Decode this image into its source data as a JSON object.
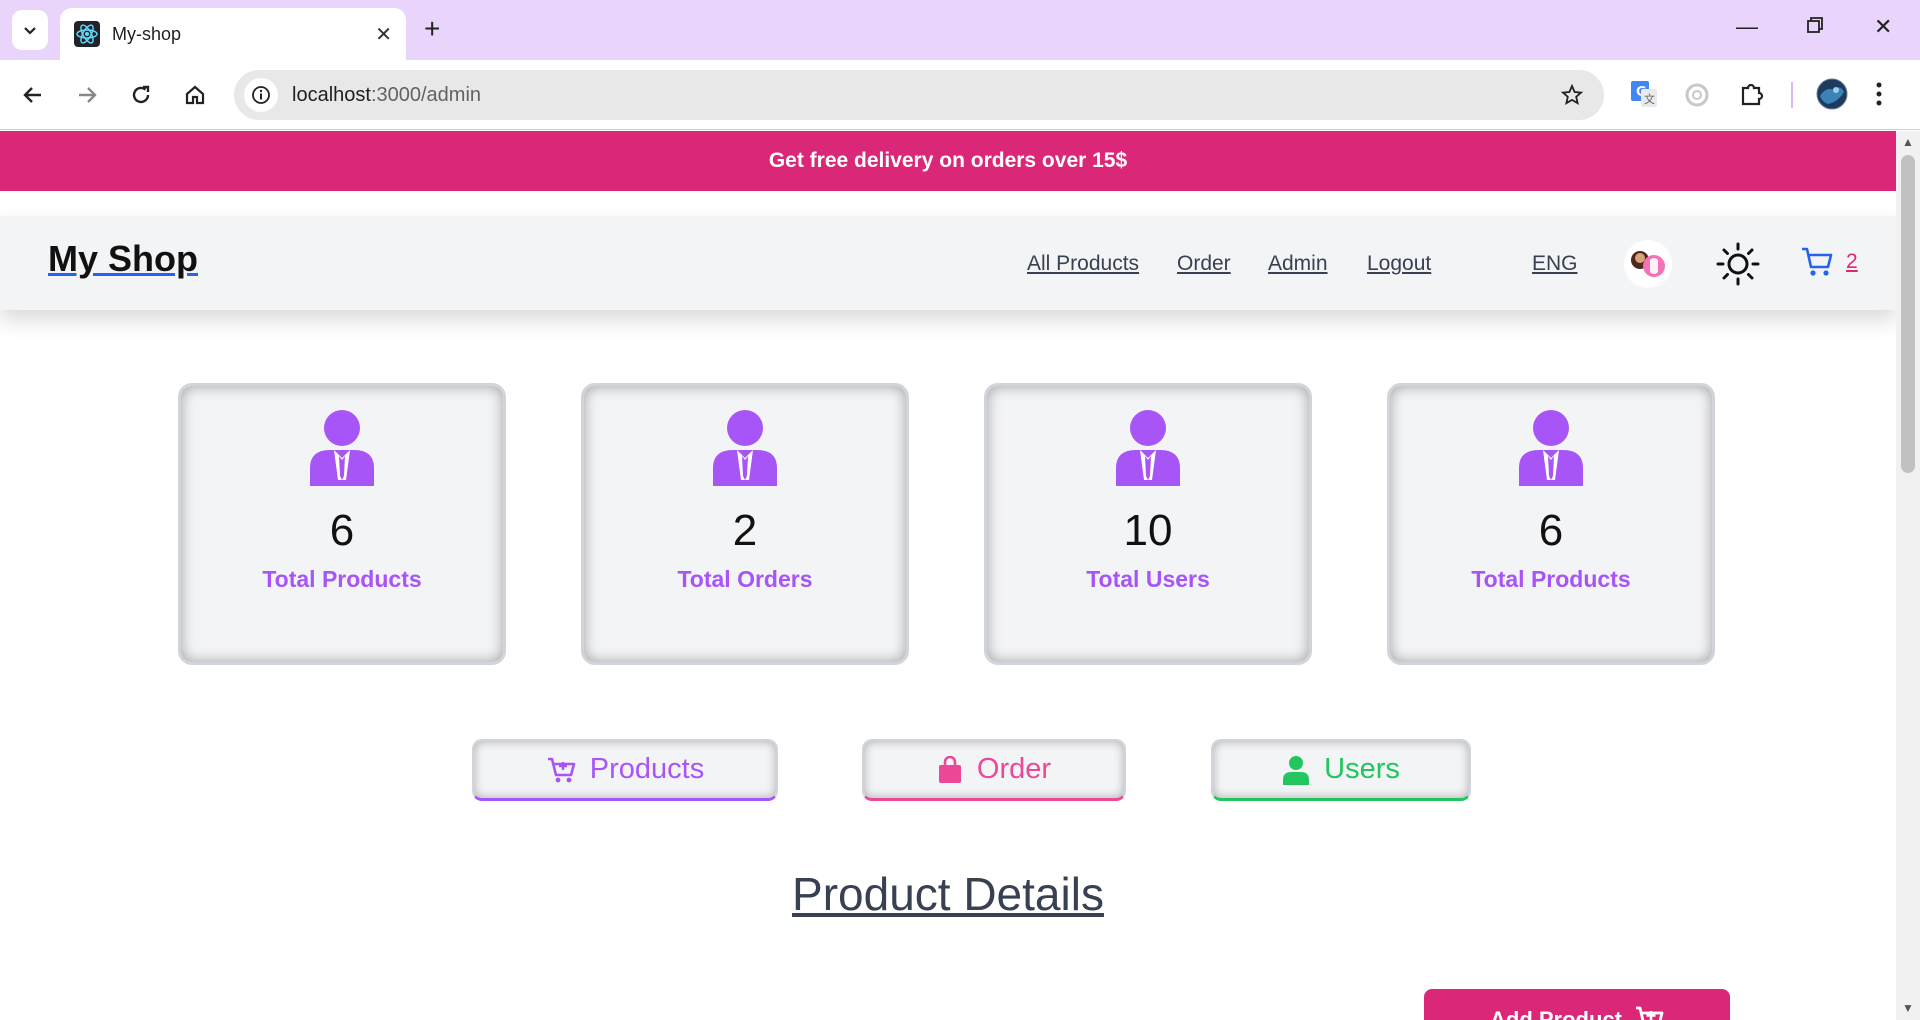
{
  "browser": {
    "tab_title": "My-shop",
    "url_host": "localhost",
    "url_path": ":3000/admin"
  },
  "promo": {
    "text": "Get free delivery on orders over 15$"
  },
  "nav": {
    "brand": "My Shop",
    "links": [
      "All Products",
      "Order",
      "Admin",
      "Logout"
    ],
    "language": "ENG",
    "cart_count": "2"
  },
  "stats": [
    {
      "value": "6",
      "label": "Total Products"
    },
    {
      "value": "2",
      "label": "Total Orders"
    },
    {
      "value": "10",
      "label": "Total Users"
    },
    {
      "value": "6",
      "label": "Total Products"
    }
  ],
  "quick_buttons": {
    "products": "Products",
    "order": "Order",
    "users": "Users"
  },
  "section": {
    "title": "Product Details"
  },
  "add_button": {
    "label": "Add Product"
  },
  "colors": {
    "accent_pink": "#db2777",
    "accent_purple": "#a855f7",
    "accent_green": "#22c55e",
    "link_blue": "#2563eb",
    "tabbar_bg": "#e9d5fb"
  },
  "icons": {
    "stat_card": "user-tie-icon",
    "products_button": "cart-icon",
    "order_button": "shopping-bag-icon",
    "users_button": "user-icon",
    "theme": "sun-icon",
    "cart": "cart-icon"
  }
}
